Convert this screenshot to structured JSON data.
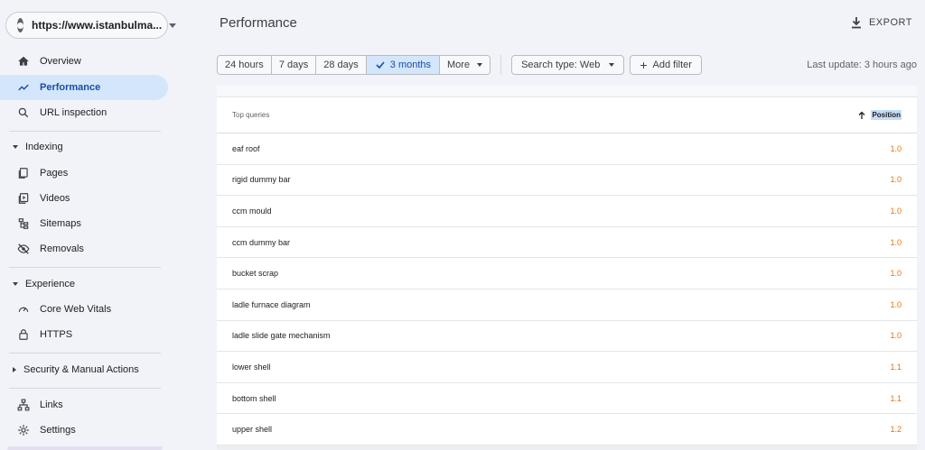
{
  "property": {
    "label": "https://www.istanbulma..."
  },
  "sidebar": {
    "top_items": [
      {
        "label": "Overview",
        "icon": "home-icon"
      },
      {
        "label": "Performance",
        "icon": "trending-up-icon",
        "active": true
      },
      {
        "label": "URL inspection",
        "icon": "search-icon"
      }
    ],
    "indexing": {
      "title": "Indexing",
      "items": [
        {
          "label": "Pages",
          "icon": "pages-icon"
        },
        {
          "label": "Videos",
          "icon": "video-icon"
        },
        {
          "label": "Sitemaps",
          "icon": "sitemap-icon"
        },
        {
          "label": "Removals",
          "icon": "visibility-off-icon"
        }
      ]
    },
    "experience": {
      "title": "Experience",
      "items": [
        {
          "label": "Core Web Vitals",
          "icon": "speed-gauge-icon"
        },
        {
          "label": "HTTPS",
          "icon": "lock-icon"
        }
      ]
    },
    "security": {
      "title": "Security & Manual Actions"
    },
    "bottom_items": [
      {
        "label": "Links",
        "icon": "links-icon"
      },
      {
        "label": "Settings",
        "icon": "gear-icon"
      }
    ]
  },
  "header": {
    "title": "Performance",
    "export_label": "EXPORT"
  },
  "toolbar": {
    "ranges": [
      {
        "label": "24 hours"
      },
      {
        "label": "7 days"
      },
      {
        "label": "28 days"
      },
      {
        "label": "3 months",
        "selected": true
      },
      {
        "label": "More"
      }
    ],
    "search_type": "Search type: Web",
    "add_filter": "Add filter",
    "last_update": "Last update: 3 hours ago"
  },
  "table": {
    "col_query": "Top queries",
    "col_position": "Position",
    "rows": [
      {
        "query": "eaf roof",
        "position": "1.0"
      },
      {
        "query": "rigid dummy bar",
        "position": "1.0"
      },
      {
        "query": "ccm mould",
        "position": "1.0"
      },
      {
        "query": "ccm dummy bar",
        "position": "1.0"
      },
      {
        "query": "bucket scrap",
        "position": "1.0"
      },
      {
        "query": "ladle furnace diagram",
        "position": "1.0"
      },
      {
        "query": "ladle slide gate mechanism",
        "position": "1.0"
      },
      {
        "query": "lower shell",
        "position": "1.1"
      },
      {
        "query": "bottom shell",
        "position": "1.1"
      },
      {
        "query": "upper shell",
        "position": "1.2"
      }
    ]
  },
  "colors": {
    "accent": "#174ea6",
    "active_bg": "#d4e6fb",
    "position_value": "#e8710a"
  }
}
